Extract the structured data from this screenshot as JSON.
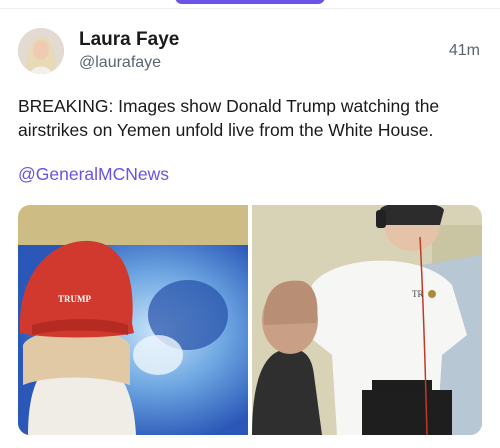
{
  "post": {
    "author": {
      "display_name": "Laura Faye",
      "handle": "@laurafaye"
    },
    "timestamp": "41m",
    "text": "BREAKING: Images show Donald Trump watching the airstrikes on Yemen unfold live from the White House.",
    "mention": "@GeneralMCNews",
    "images": [
      {
        "cap_text": "TRUMP"
      },
      {
        "shirt_text": "TR"
      }
    ]
  },
  "colors": {
    "accent": "#6a53e6",
    "text": "#1a1a1a",
    "secondary": "#5b6470"
  }
}
